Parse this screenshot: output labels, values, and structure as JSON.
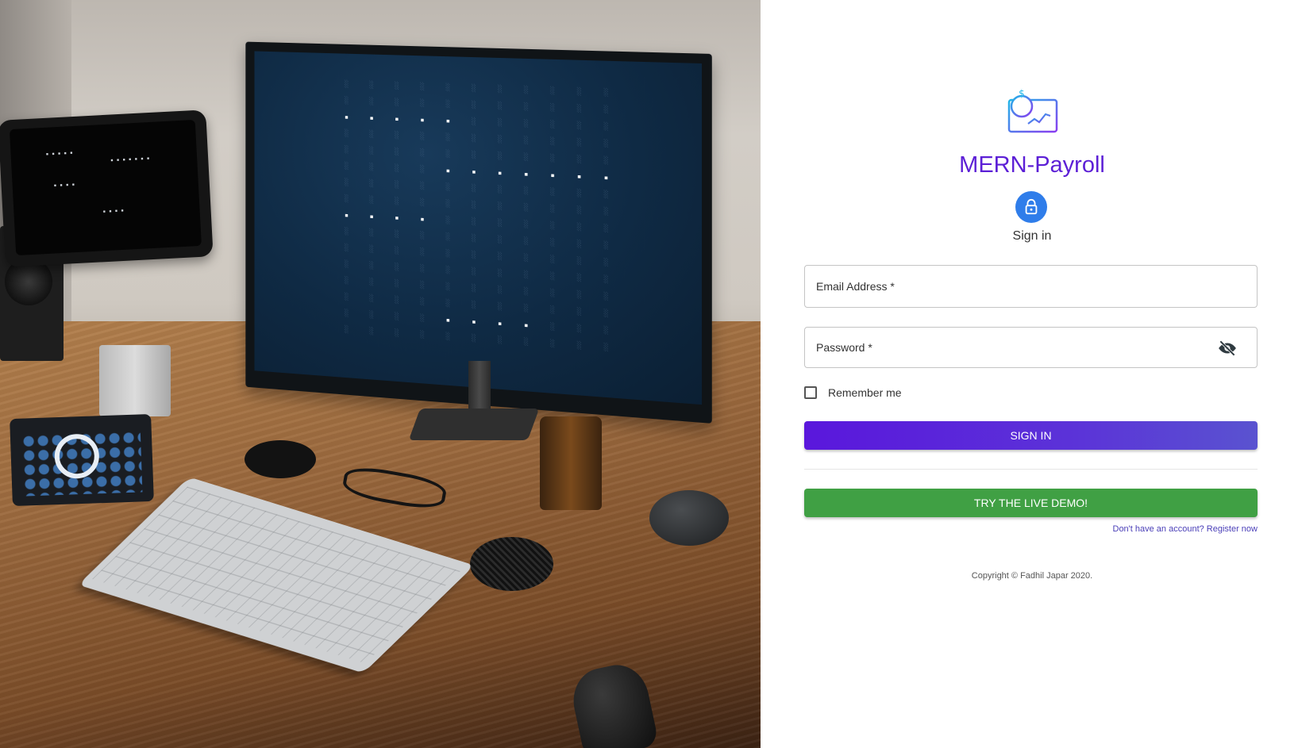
{
  "brand": {
    "title": "MERN-Payroll",
    "primary_color": "#5c1fd6",
    "logo_icon": "payroll-dashboard-icon"
  },
  "signin": {
    "heading": "Sign in",
    "avatar_icon": "lock-icon",
    "avatar_color": "#2f7dea"
  },
  "form": {
    "email_label": "Email Address *",
    "password_label": "Password *",
    "password_toggle_icon": "visibility-off-icon",
    "remember_label": "Remember me",
    "signin_button": "SIGN IN",
    "demo_button": "TRY THE LIVE DEMO!",
    "demo_color": "#40a044",
    "register_link": "Don't have an account? Register now"
  },
  "footer": {
    "copyright": "Copyright © Fadhil Japar 2020."
  },
  "hero": {
    "image_icon": "desk-setup-photo",
    "monitor_words_lit": [
      "EIGHT",
      "MINUTES",
      "PAST",
      "FOUR"
    ]
  }
}
